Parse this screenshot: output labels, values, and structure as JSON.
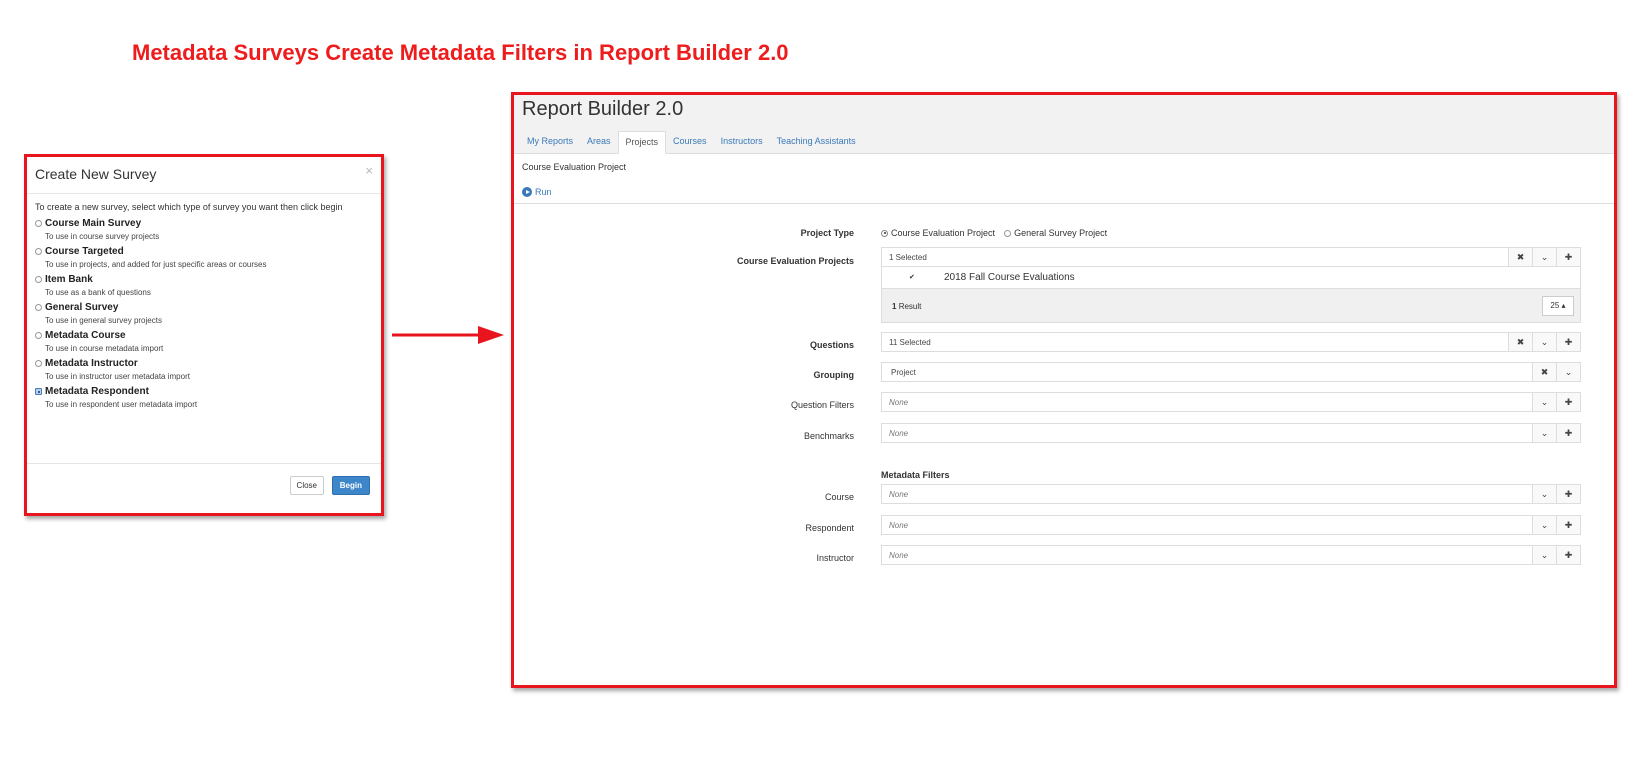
{
  "headline": "Metadata Surveys Create Metadata Filters in Report Builder 2.0",
  "modal": {
    "title": "Create New Survey",
    "close_icon": "×",
    "intro": "To create a new survey, select which type of survey you want then click begin",
    "options": [
      {
        "label": "Course Main Survey",
        "desc": "To use in course survey projects"
      },
      {
        "label": "Course Targeted",
        "desc": "To use in projects, and added for just specific areas or courses"
      },
      {
        "label": "Item Bank",
        "desc": "To use as a bank of questions"
      },
      {
        "label": "General Survey",
        "desc": "To use in general survey projects"
      },
      {
        "label": "Metadata Course",
        "desc": "To use in course metadata import"
      },
      {
        "label": "Metadata Instructor",
        "desc": "To use in instructor user metadata import"
      },
      {
        "label": "Metadata Respondent",
        "desc": "To use in respondent user metadata import"
      }
    ],
    "close_label": "Close",
    "begin_label": "Begin"
  },
  "report_builder": {
    "title": "Report Builder 2.0",
    "tabs": [
      "My Reports",
      "Areas",
      "Projects",
      "Courses",
      "Instructors",
      "Teaching Assistants"
    ],
    "active_tab": "Projects",
    "breadcrumb": "Course Evaluation Project",
    "run_label": "Run",
    "project_type": {
      "label": "Project Type",
      "option_1": "Course Evaluation Project",
      "option_2": "General Survey Project"
    },
    "course_eval_projects": {
      "label": "Course Evaluation Projects",
      "value": "1 Selected",
      "list_item": "2018 Fall Course Evaluations",
      "check_mark": "✔",
      "result_count": "1",
      "result_word": "Result",
      "page_size": "25 ▴"
    },
    "questions": {
      "label": "Questions",
      "value": "11 Selected"
    },
    "grouping": {
      "label": "Grouping",
      "value": "Project"
    },
    "question_filters": {
      "label": "Question Filters",
      "value": "None"
    },
    "benchmarks": {
      "label": "Benchmarks",
      "value": "None"
    },
    "metadata_filters": {
      "title": "Metadata Filters",
      "course": {
        "label": "Course",
        "value": "None"
      },
      "respondent": {
        "label": "Respondent",
        "value": "None"
      },
      "instructor": {
        "label": "Instructor",
        "value": "None"
      }
    },
    "icons": {
      "clear": "✖",
      "dropdown": "⌄",
      "add": "✚"
    }
  },
  "colors": {
    "accent_red": "#ee1c1c",
    "link_blue": "#3a79b8",
    "begin_blue": "#3c86c9"
  }
}
